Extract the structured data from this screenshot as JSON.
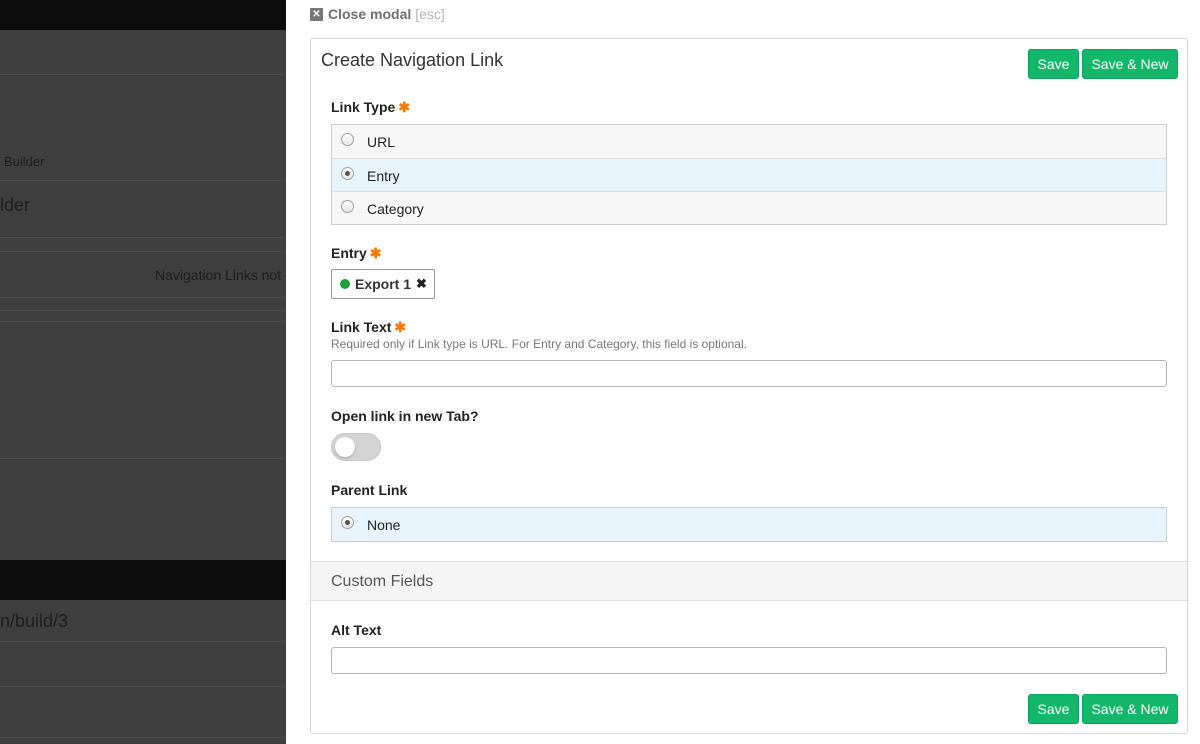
{
  "background": {
    "texts": [
      "Builder",
      "lder",
      "Navigation Links not",
      "n/build/3"
    ]
  },
  "modal": {
    "close_label": "Close modal",
    "close_hint": "[esc]",
    "title": "Create Navigation Link",
    "save_label": "Save",
    "save_new_label": "Save & New",
    "required_mark": "✱",
    "link_type": {
      "label": "Link Type",
      "options": [
        "URL",
        "Entry",
        "Category"
      ],
      "selected": "Entry"
    },
    "entry": {
      "label": "Entry",
      "chip_text": "Export 1",
      "chip_status_color": "#1e9e3e"
    },
    "link_text": {
      "label": "Link Text",
      "help": "Required only if Link type is URL. For Entry and Category, this field is optional.",
      "value": ""
    },
    "open_new_tab": {
      "label": "Open link in new Tab?",
      "checked": false
    },
    "parent_link": {
      "label": "Parent Link",
      "options": [
        "None"
      ],
      "selected": "None"
    },
    "custom_fields": {
      "heading": "Custom Fields",
      "alt_text_label": "Alt Text",
      "alt_text_value": ""
    }
  },
  "colors": {
    "button_green": "#12b76a",
    "required_orange": "#f57c00",
    "selected_row": "#e8f4fb"
  }
}
